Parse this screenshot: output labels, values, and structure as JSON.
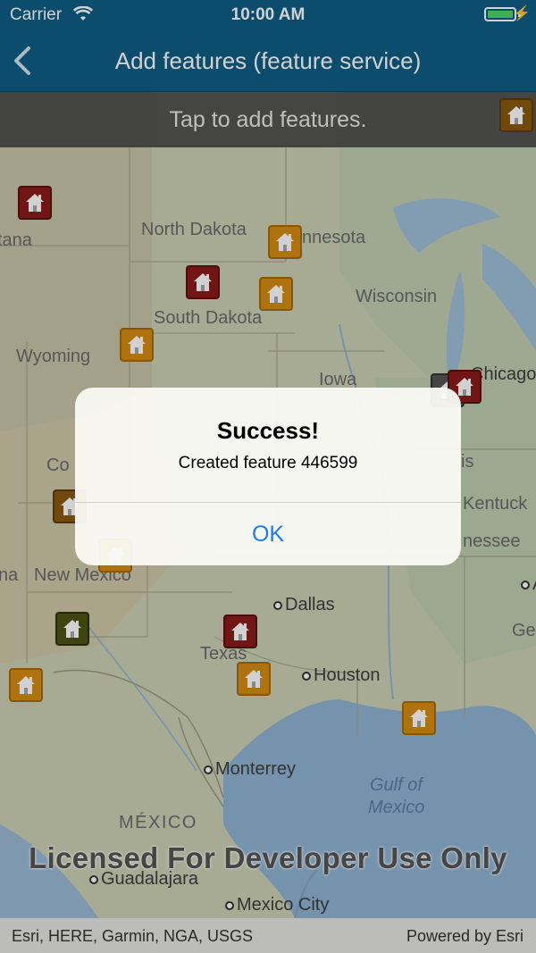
{
  "status_bar": {
    "carrier": "Carrier",
    "time": "10:00 AM"
  },
  "nav": {
    "title": "Add features (feature service)",
    "back_icon": "chevron-left-icon"
  },
  "banner": {
    "text": "Tap to add features."
  },
  "map": {
    "labels": {
      "montana": "tana",
      "north_dakota": "North Dakota",
      "minnesota": "nnesota",
      "wisconsin": "Wisconsin",
      "south_dakota": "South Dakota",
      "wyoming": "Wyoming",
      "iowa": "Iowa",
      "chicago": "Chicago",
      "colorado": "Co",
      "illinois": "is",
      "kentucky": "Kentuck",
      "tennessee": "nessee",
      "new_mexico": "New Mexico",
      "arizona": "na",
      "dallas": "Dallas",
      "texas": "Texas",
      "houston": "Houston",
      "georgia": "Ge",
      "alabama": "A",
      "monterrey": "Monterrey",
      "gulf_of_mexico_1": "Gulf of",
      "gulf_of_mexico_2": "Mexico",
      "mexico": "MÉXICO",
      "guadalajara": "Guadalajara",
      "mexico_city": "Mexico City"
    },
    "watermark": "Licensed For Developer Use Only",
    "attribution_left": "Esri, HERE, Garmin, NGA, USGS",
    "attribution_right": "Powered by Esri",
    "marker_icon": "house-icon",
    "marker_colors": {
      "red": "#8b1a1a",
      "orange": "#d58c13",
      "olive": "#4d5313",
      "brown": "#8a5a10",
      "gray": "#555555"
    }
  },
  "alert": {
    "title": "Success!",
    "message": "Created feature 446599",
    "ok_label": "OK"
  }
}
